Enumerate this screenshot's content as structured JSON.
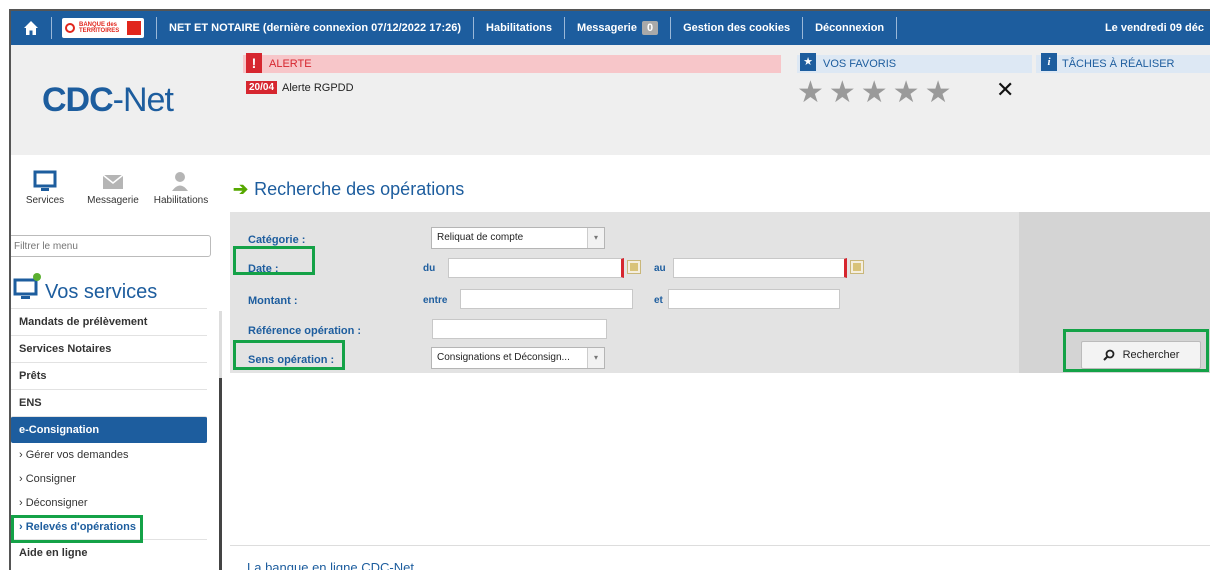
{
  "topbar": {
    "logo_text": "BANQUE des TERRITOIRES",
    "user": "NET ET NOTAIRE (dernière connexion 07/12/2022 17:26)",
    "habilitations": "Habilitations",
    "messagerie": "Messagerie",
    "message_count": "0",
    "cookies": "Gestion des cookies",
    "logout": "Déconnexion",
    "date": "Le vendredi 09 déc"
  },
  "header": {
    "brand_bold": "CDC",
    "brand_rest": "-Net",
    "alert_title": "ALERTE",
    "alert_date": "20/04",
    "alert_text": "Alerte RGPDD",
    "favorites_title": "VOS FAVORIS",
    "tasks_title": "TÂCHES À RÉALISER"
  },
  "sidebar": {
    "icons": [
      {
        "label": "Services"
      },
      {
        "label": "Messagerie"
      },
      {
        "label": "Habilitations"
      }
    ],
    "filter_placeholder": "Filtrer le menu",
    "section_title": "Vos services",
    "items": [
      {
        "label": "Mandats de prélèvement"
      },
      {
        "label": "Services Notaires"
      },
      {
        "label": "Prêts"
      },
      {
        "label": "ENS"
      },
      {
        "label": "e-Consignation"
      }
    ],
    "subitems": [
      {
        "label": "Gérer vos demandes"
      },
      {
        "label": "Consigner"
      },
      {
        "label": "Déconsigner"
      },
      {
        "label": "Relevés d'opérations"
      }
    ],
    "help": "Aide en ligne"
  },
  "main": {
    "title": "Recherche des opérations",
    "categorie_label": "Catégorie :",
    "categorie_value": "Reliquat de compte",
    "date_label": "Date :",
    "du": "du",
    "au": "au",
    "montant_label": "Montant :",
    "entre": "entre",
    "et": "et",
    "reference_label": "Référence opération :",
    "sens_label": "Sens opération :",
    "sens_value": "Consignations et Déconsign...",
    "search_button": "Rechercher"
  },
  "footer": {
    "text": "La banque en ligne CDC-Net"
  },
  "colors": {
    "brand_blue": "#1d5d9e",
    "alert_red": "#d6262f",
    "highlight_green": "#14a247"
  }
}
